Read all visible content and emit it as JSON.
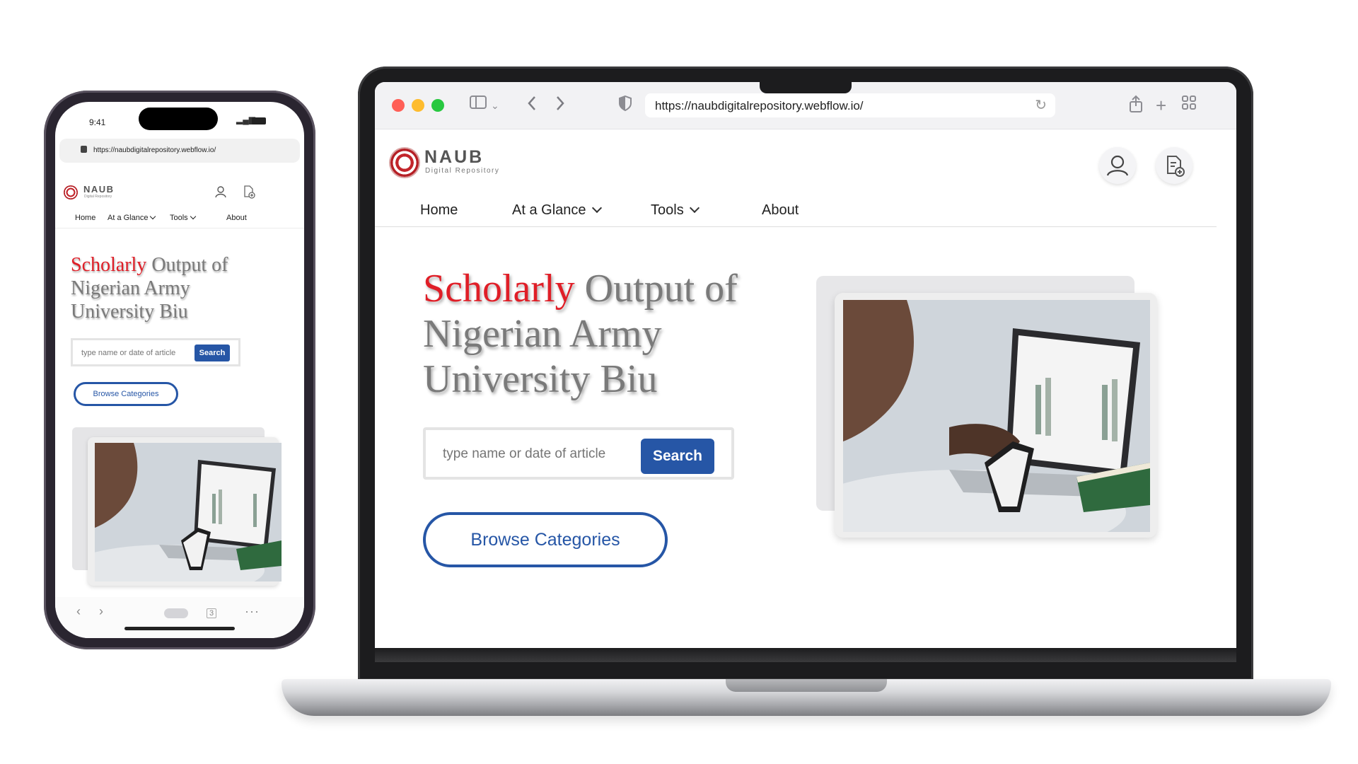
{
  "browser": {
    "url": "https://naubdigitalrepository.webflow.io/"
  },
  "site": {
    "brand": "NAUB",
    "brand_subtitle": "Digital Repository",
    "nav": {
      "home": "Home",
      "at_a_glance": "At a  Glance",
      "tools": "Tools",
      "about": "About"
    },
    "hero": {
      "title_highlight": "Scholarly",
      "title_rest": " Output of Nigerian Army University Biu",
      "search_placeholder": "type name or date of article",
      "search_button": "Search",
      "browse_button": "Browse Categories"
    }
  },
  "phone": {
    "time": "9:41",
    "url": "https://naubdigitalrepository.webflow.io/",
    "tab_count": "3"
  },
  "colors": {
    "accent_red": "#e01e27",
    "primary_blue": "#2656a6",
    "heading_gray": "#7a7a7a"
  },
  "icons": {
    "user": "user-icon",
    "document_add": "document-add-icon",
    "back": "chevron-left-icon",
    "forward": "chevron-right-icon",
    "sidebar": "sidebar-icon",
    "shield": "shield-icon",
    "reload": "reload-icon",
    "share": "share-icon",
    "new_tab": "plus-icon",
    "tabs": "tabs-grid-icon",
    "lock": "lock-icon",
    "more": "more-icon"
  }
}
